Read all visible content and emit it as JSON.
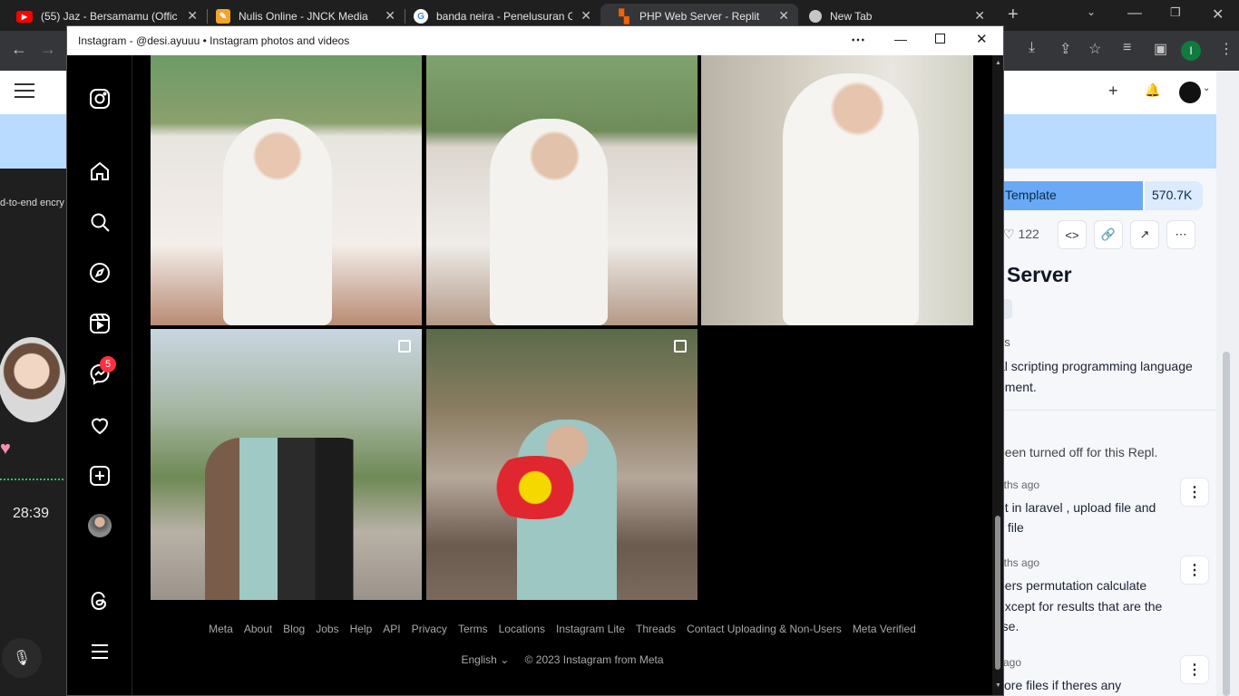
{
  "browser": {
    "tabs": [
      {
        "title": "(55) Jaz - Bersamamu (Offici",
        "color": "#ff0000"
      },
      {
        "title": "Nulis Online - JNCK Media",
        "color": "#f4a32c"
      },
      {
        "title": "banda neira - Penelusuran G",
        "color": "#ffffff"
      },
      {
        "title": "PHP Web Server - Replit",
        "color": "#f26207"
      },
      {
        "title": "New Tab",
        "color": "#c4c7c5"
      }
    ],
    "profile_initial": "I"
  },
  "leftapp": {
    "banner": "d-to-end encry",
    "time": "28:39"
  },
  "replit": {
    "template_label": "Template",
    "template_count": "570.7K",
    "likes": "122",
    "title": "Server",
    "section_label": "ns",
    "desc_line1": "al scripting programming language",
    "desc_line2": "oment.",
    "comments_off": "been turned off for this Repl.",
    "comments": [
      {
        "time": "nths ago",
        "line1": "et in laravel , upload file and",
        "line2": "s file"
      },
      {
        "time": "nths ago",
        "line1": "bers permutation calculate",
        "line2": "except for results that are the",
        "line3": "rse."
      },
      {
        "time": "ago",
        "line1": "core files if theres any"
      }
    ]
  },
  "window": {
    "title": "Instagram - @desi.ayuuu • Instagram photos and videos"
  },
  "instagram": {
    "notif_count": "5",
    "footer_links": [
      "Meta",
      "About",
      "Blog",
      "Jobs",
      "Help",
      "API",
      "Privacy",
      "Terms",
      "Locations",
      "Instagram Lite",
      "Threads",
      "Contact Uploading & Non-Users",
      "Meta Verified"
    ],
    "language": "English",
    "copyright": "© 2023 Instagram from Meta"
  }
}
